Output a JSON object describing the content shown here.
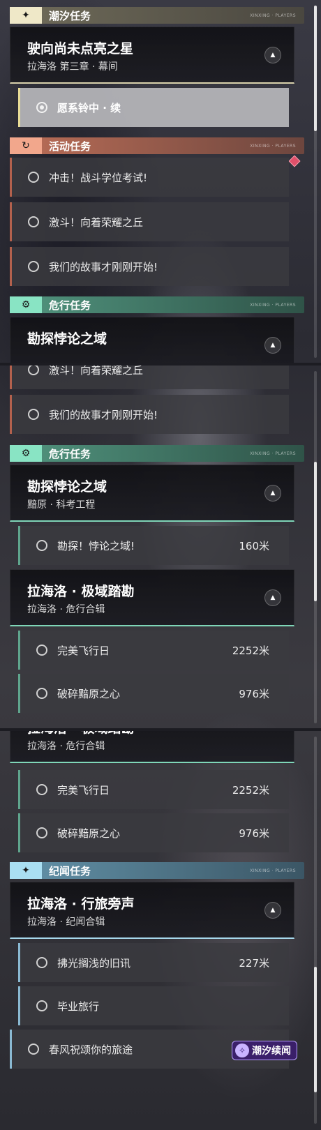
{
  "categories": {
    "tide": "潮汐任务",
    "event": "活动任务",
    "danger": "危行任务",
    "lore": "纪闻任务"
  },
  "quests": {
    "tide_main": {
      "title": "驶向尚未点亮之星",
      "subtitle": "拉海洛 第三章 · 幕间"
    },
    "tide_step": "愿系铃中 · 续",
    "event_items": [
      "冲击！战斗学位考试!",
      "激斗！向着荣耀之丘",
      "我们的故事才刚刚开始!"
    ],
    "danger_main": {
      "title": "勘探悖论之域",
      "subtitle": "黯原 · 科考工程"
    },
    "danger_main_cut": "黯原 · 科考工程",
    "danger_step": {
      "label": "勘探！悖论之域!",
      "distance": "160米"
    },
    "danger_second": {
      "title": "拉海洛 · 极域踏勘",
      "subtitle": "拉海洛 · 危行合辑"
    },
    "danger_second_steps": [
      {
        "label": "完美飞行日",
        "distance": "2252米"
      },
      {
        "label": "破碎黯原之心",
        "distance": "976米"
      }
    ],
    "lore_main": {
      "title": "拉海洛 · 行旅旁声",
      "subtitle": "拉海洛 · 纪闻合辑"
    },
    "lore_steps": [
      {
        "label": "拂光搁浅的旧讯",
        "distance": "227米"
      },
      {
        "label": "毕业旅行",
        "distance": ""
      },
      {
        "label": "春风祝颂你的旅途",
        "distance": ""
      }
    ]
  },
  "cat_tag": "XINXING · PLAYERS",
  "logo": "潮汐续闻",
  "icons": {
    "tide": "sparkle-icon",
    "event": "refresh-icon",
    "danger": "gear-icon",
    "lore": "sparkle-icon",
    "collapse": "chevron-up-icon"
  }
}
